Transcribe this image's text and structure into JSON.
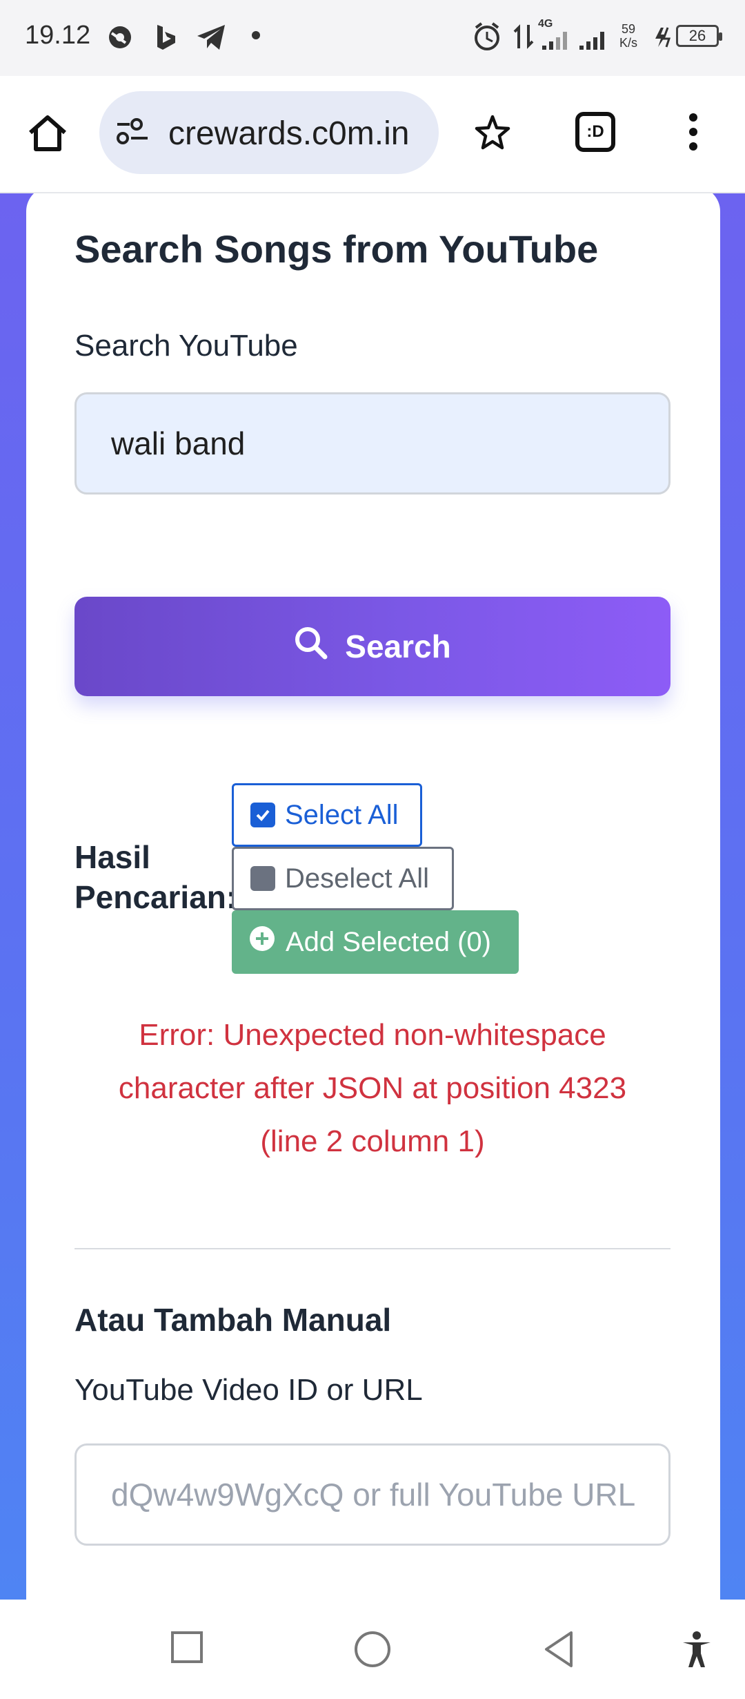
{
  "status_bar": {
    "time": "19.12",
    "net_speed_value": "59",
    "net_speed_unit": "K/s",
    "network": "4G",
    "battery": "26"
  },
  "browser": {
    "url": "crewards.c0m.in",
    "tab_label": ":D"
  },
  "main": {
    "section_title": "Search Songs from YouTube",
    "search_label": "Search YouTube",
    "search_value": "wali band",
    "search_button": "Search",
    "results_label": "Hasil Pencarian:",
    "select_all": "Select All",
    "deselect_all": "Deselect All",
    "add_selected": "Add Selected (0)",
    "error_message": "Error: Unexpected non-whitespace character after JSON at position 4323 (line 2 column 1)",
    "manual_title": "Atau Tambah Manual",
    "manual_label": "YouTube Video ID or URL",
    "manual_placeholder": "dQw4w9WgXcQ or full YouTube URL"
  },
  "colors": {
    "primary_purple": "#7b58e6",
    "select_blue": "#1a5fd6",
    "add_green": "#63b38a",
    "error_red": "#d0323f"
  },
  "icons": [
    "home-icon",
    "site-settings-icon",
    "star-icon",
    "tabs-icon",
    "more-vert-icon",
    "search-icon",
    "checkbox-checked-icon",
    "checkbox-empty-icon",
    "plus-circle-icon",
    "recent-apps-icon",
    "home-circle-icon",
    "back-icon",
    "accessibility-icon"
  ]
}
